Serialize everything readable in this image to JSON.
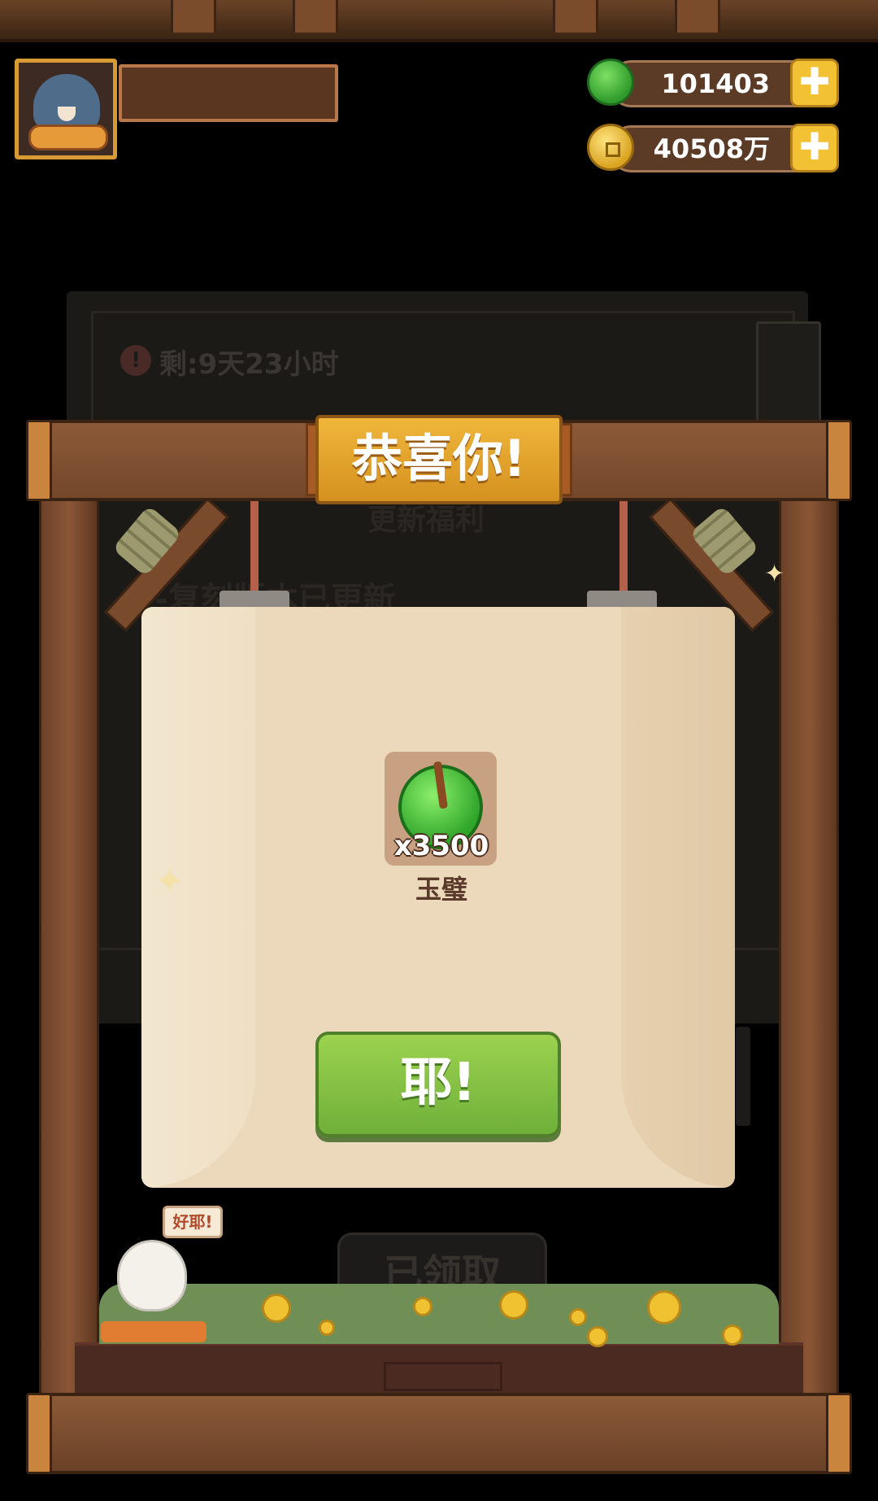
{
  "currencies": {
    "jade": {
      "icon": "jade-disc-icon",
      "value": "101403"
    },
    "coins": {
      "icon": "coin-icon",
      "value": "40508万"
    },
    "add_symbol": "✚"
  },
  "background_board": {
    "timer_icon": "!",
    "timer_text": "剩:9天23小时",
    "section_title": "更新福利",
    "update_line": "-复刻版本已更新",
    "claimed_button": "已领取"
  },
  "dialog": {
    "title": "恭喜你!",
    "reward": {
      "icon": "jade-disc-icon",
      "quantity": "x3500",
      "name": "玉璧"
    },
    "confirm_label": "耶!"
  },
  "mascot": {
    "speech": "好耶!"
  },
  "colors": {
    "banner": "#e0a02a",
    "confirm_button": "#86c244",
    "panel": "#ecd9bb",
    "frame": "#7d4e31"
  }
}
